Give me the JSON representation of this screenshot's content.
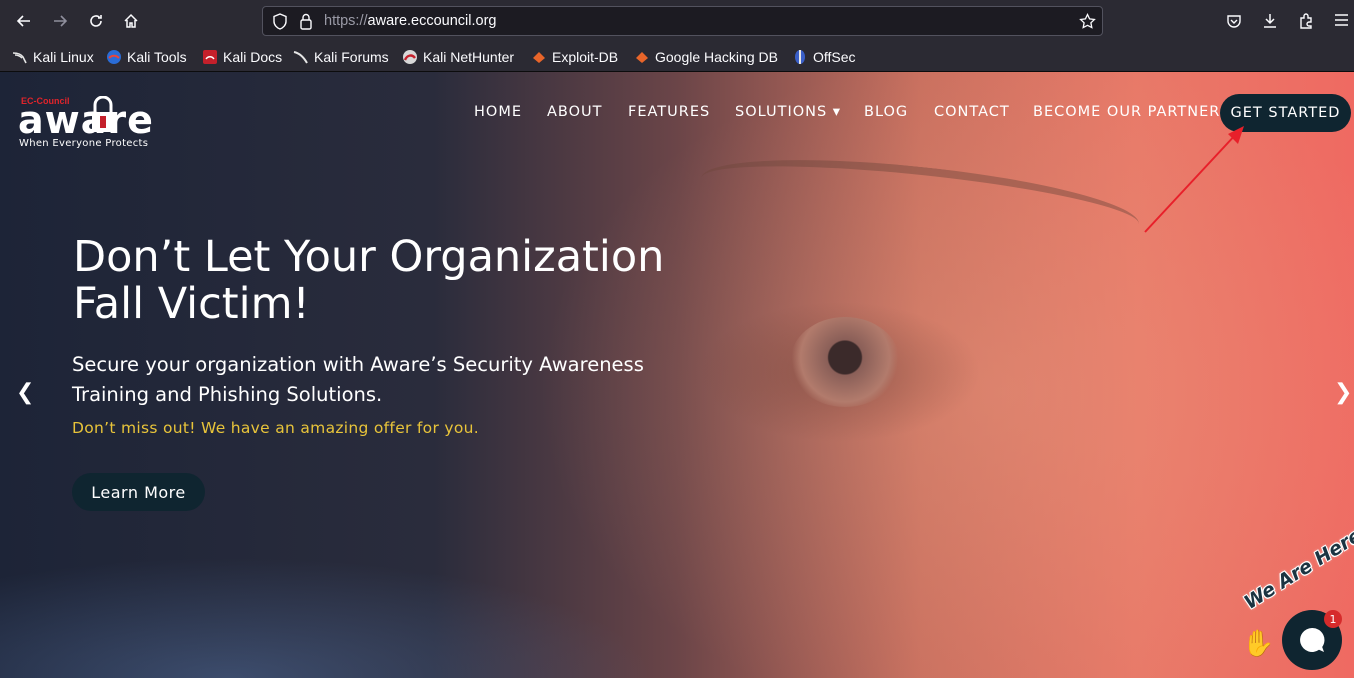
{
  "browser": {
    "url_prefix": "https://",
    "url_host": "aware.eccouncil.org",
    "bookmarks": [
      {
        "label": "Kali Linux"
      },
      {
        "label": "Kali Tools"
      },
      {
        "label": "Kali Docs"
      },
      {
        "label": "Kali Forums"
      },
      {
        "label": "Kali NetHunter"
      },
      {
        "label": "Exploit-DB"
      },
      {
        "label": "Google Hacking DB"
      },
      {
        "label": "OffSec"
      }
    ]
  },
  "logo": {
    "brand_small": "EC-Council",
    "wordmark": "aware",
    "tagline": "When Everyone Protects"
  },
  "nav": {
    "items": [
      "HOME",
      "ABOUT",
      "FEATURES",
      "SOLUTIONS",
      "BLOG",
      "CONTACT",
      "BECOME OUR PARTNER"
    ],
    "solutions_caret": "▾",
    "cta": "GET STARTED"
  },
  "hero": {
    "title_line1": "Don’t Let Your Organization",
    "title_line2": "Fall Victim!",
    "subtitle_line1": "Secure your organization with Aware’s Security Awareness",
    "subtitle_line2": "Training and Phishing Solutions.",
    "offer": "Don’t miss out! We have an amazing offer for you.",
    "button": "Learn More",
    "prev": "❮",
    "next": "❯"
  },
  "chat": {
    "label": "We Are Here!",
    "badge": "1"
  },
  "colors": {
    "cta_bg": "#0f2530",
    "offer_text": "#e8c43a",
    "annotation_arrow": "#e8202a"
  }
}
